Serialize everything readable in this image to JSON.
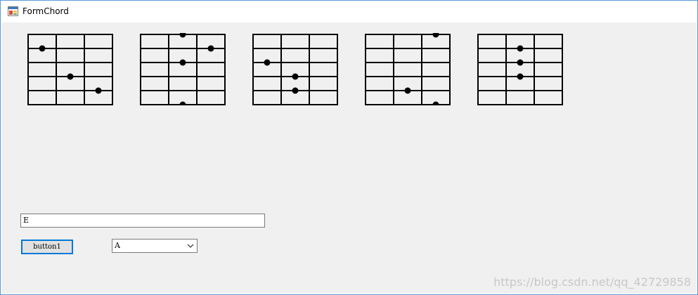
{
  "window": {
    "title": "FormChord"
  },
  "chords": [
    {
      "dots": [
        [
          0,
          1
        ],
        [
          1,
          3
        ],
        [
          2,
          4
        ]
      ]
    },
    {
      "dots": [
        [
          1,
          0
        ],
        [
          2,
          1
        ],
        [
          1,
          2
        ],
        [
          1,
          5
        ]
      ]
    },
    {
      "dots": [
        [
          0,
          2
        ],
        [
          1,
          3
        ],
        [
          1,
          4
        ]
      ]
    },
    {
      "dots": [
        [
          2,
          0
        ],
        [
          1,
          4
        ],
        [
          2,
          5
        ]
      ]
    },
    {
      "dots": [
        [
          1,
          1
        ],
        [
          1,
          2
        ],
        [
          1,
          3
        ]
      ]
    }
  ],
  "controls": {
    "textbox_value": "E",
    "button_label": "button1",
    "combo_value": "A"
  },
  "watermark": "https://blog.csdn.net/qq_42729858",
  "colors": {
    "window_border": "#5a9bd5",
    "client_bg": "#f0f0f0",
    "button_focus": "#0078d7"
  }
}
